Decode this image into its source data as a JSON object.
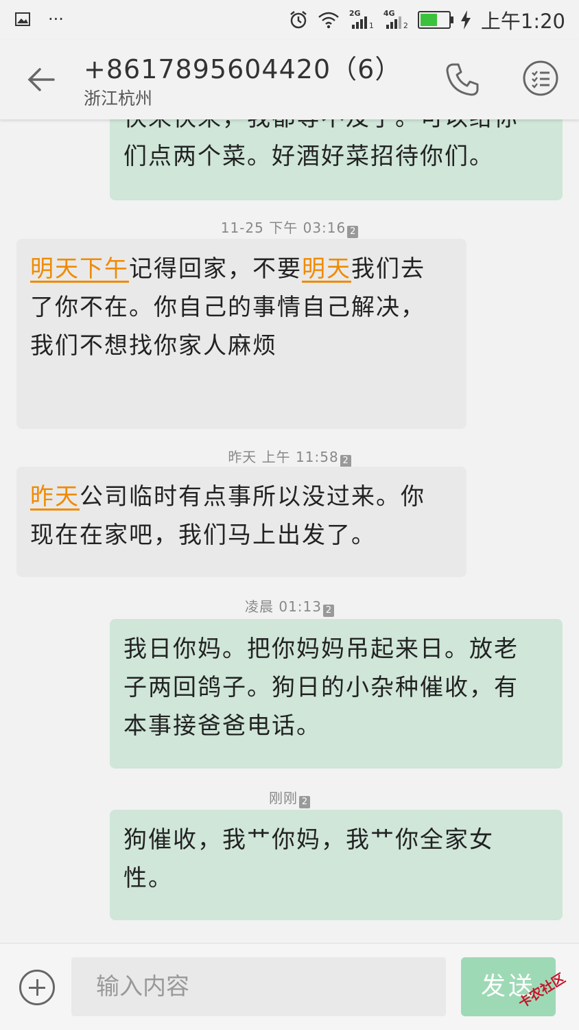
{
  "status_bar": {
    "time": "上午1:20",
    "net1_label": "2G",
    "net1_sim": "1",
    "net2_label": "4G",
    "net2_sim": "2",
    "more": "···"
  },
  "header": {
    "title": "+8617895604420（6）",
    "location": "浙江杭州"
  },
  "messages": [
    {
      "direction": "out",
      "line1": "快来快来，我都等不及了。可以给你",
      "line2": "们点两个菜。好酒好菜招待你们。"
    },
    {
      "timestamp": "11-25  下午  03:16",
      "sim": "2",
      "direction": "in",
      "line1_link1": "明天下午",
      "line1_text1": "记得回家，不要",
      "line1_link2": "明天",
      "line1_text2": "我们去",
      "line2": "了你不在。你自己的事情自己解决，",
      "line3": "我们不想找你家人麻烦"
    },
    {
      "timestamp": "昨天  上午  11:58",
      "sim": "2",
      "direction": "in",
      "line1_link": "昨天",
      "line1_text": "公司临时有点事所以没过来。你",
      "line2": "现在在家吧，我们马上出发了。"
    },
    {
      "timestamp": "凌晨  01:13",
      "sim": "2",
      "direction": "out",
      "line1": "我日你妈。把你妈妈吊起来日。放老",
      "line2": "子两回鸽子。狗日的小杂种催收，有",
      "line3": "本事接爸爸电话。"
    },
    {
      "timestamp": "刚刚",
      "sim": "2",
      "direction": "out",
      "line1": "狗催收，我艹你妈，我艹你全家女",
      "line2": "性。"
    }
  ],
  "input_bar": {
    "placeholder": "输入内容",
    "send_label": "发送",
    "watermark": "卡农社区"
  },
  "colors": {
    "incoming_bubble": "#e9e9e9",
    "outgoing_bubble": "#cfe6d8",
    "link": "#f08a00",
    "send_button": "#9ed9b6",
    "battery": "#3cc13c"
  }
}
